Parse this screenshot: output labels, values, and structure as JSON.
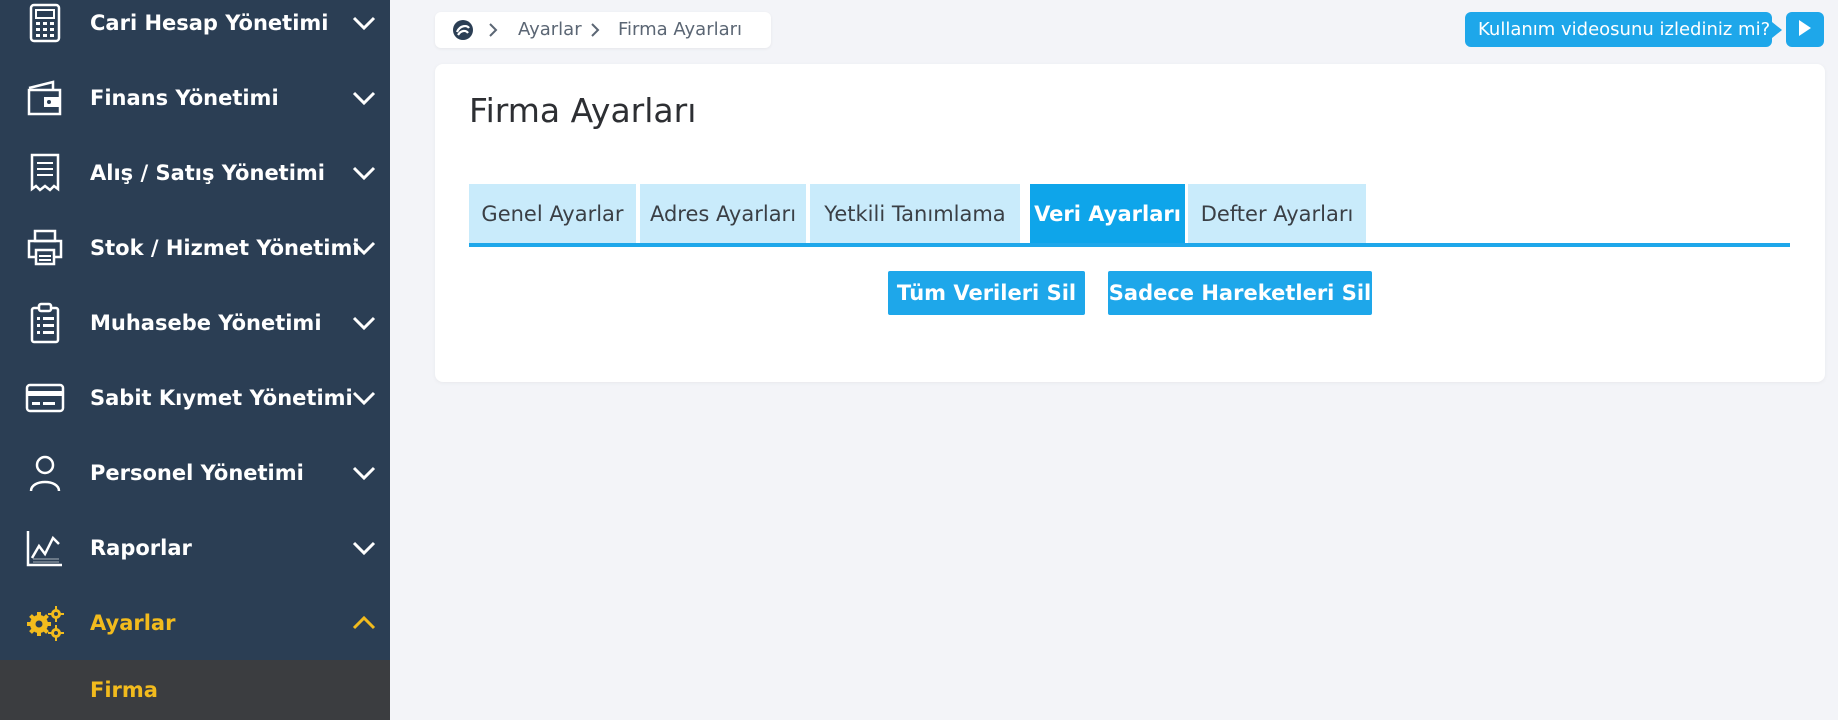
{
  "sidebar": {
    "items": [
      {
        "label": "Cari Hesap Yönetimi",
        "icon": "calculator-icon"
      },
      {
        "label": "Finans Yönetimi",
        "icon": "wallet-icon"
      },
      {
        "label": "Alış / Satış Yönetimi",
        "icon": "receipt-icon"
      },
      {
        "label": "Stok / Hizmet Yönetimi",
        "icon": "printer-icon"
      },
      {
        "label": "Muhasebe Yönetimi",
        "icon": "clipboard-icon"
      },
      {
        "label": "Sabit Kıymet Yönetimi",
        "icon": "credit-card-icon"
      },
      {
        "label": "Personel Yönetimi",
        "icon": "user-icon"
      },
      {
        "label": "Raporlar",
        "icon": "chart-icon"
      },
      {
        "label": "Ayarlar",
        "icon": "gears-icon",
        "active": true
      }
    ],
    "submenu": {
      "label": "Firma"
    }
  },
  "breadcrumb": {
    "items": [
      "Ayarlar",
      "Firma Ayarları"
    ]
  },
  "video_prompt": {
    "label": "Kullanım videosunu izlediniz mi?"
  },
  "page": {
    "title": "Firma Ayarları",
    "tabs": [
      "Genel Ayarlar",
      "Adres Ayarları",
      "Yetkili Tanımlama",
      "Veri Ayarları",
      "Defter Ayarları"
    ],
    "active_tab": "Veri Ayarları",
    "buttons": {
      "delete_all": "Tüm Verileri Sil",
      "delete_movements": "Sadece Hareketleri Sil"
    }
  },
  "colors": {
    "sidebar_bg": "#2b3e54",
    "accent": "#1ea7ea",
    "active_nav": "#f2bb1d",
    "tab_bg": "#c9ebfb"
  }
}
